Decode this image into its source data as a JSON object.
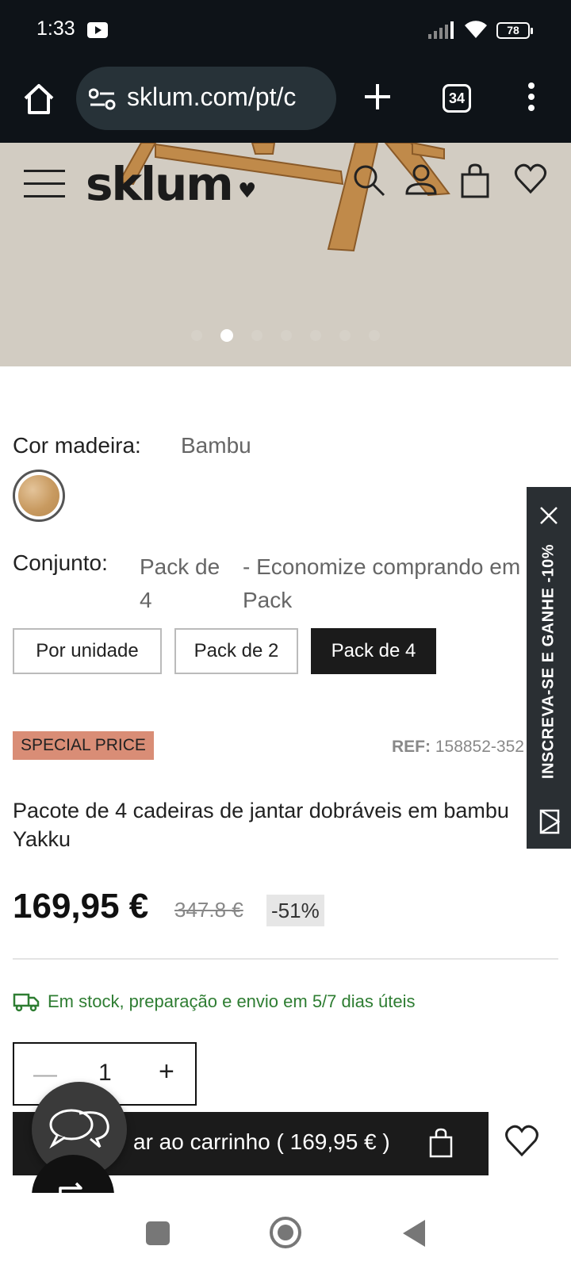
{
  "status": {
    "time": "1:33",
    "battery": "78"
  },
  "browser": {
    "url": "sklum.com/pt/c",
    "tab_count": "34"
  },
  "header": {
    "logo": "sklum",
    "carousel": {
      "dot_count": 7,
      "active_index": 1
    }
  },
  "product": {
    "color_label": "Cor madeira:",
    "color_value": "Bambu",
    "set_label": "Conjunto:",
    "set_value": "Pack de 4",
    "set_note": "- Economize comprando em Pack",
    "options": [
      {
        "label": "Por unidade",
        "selected": false
      },
      {
        "label": "Pack de 2",
        "selected": false
      },
      {
        "label": "Pack de 4",
        "selected": true
      }
    ],
    "badge": "SPECIAL PRICE",
    "ref_label": "REF:",
    "ref_value": "158852-352",
    "title": "Pacote de 4 cadeiras de jantar dobráveis em bambu Yakku",
    "price": "169,95 €",
    "old_price": "347.8 €",
    "discount": "-51%",
    "stock": "Em stock, preparação e envio em 5/7 dias úteis",
    "quantity": "1",
    "cart_label": "ar ao carrinho ( 169,95 € )"
  },
  "side_tab": {
    "label": "INSCREVA-SE E GANHE -10%"
  },
  "colors": {
    "accent_badge": "#d98d76",
    "stock_green": "#2e7d32",
    "dark": "#1b1b1b"
  }
}
